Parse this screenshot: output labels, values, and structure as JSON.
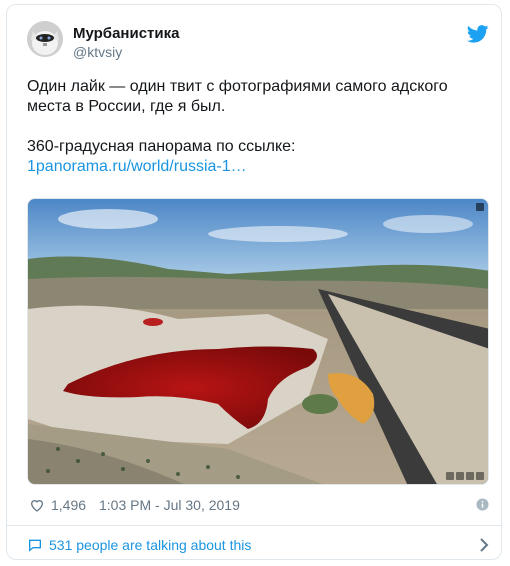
{
  "author": {
    "display_name": "Мурбанистика",
    "handle": "@ktvsiy",
    "avatar_icon": "cat-avatar"
  },
  "tweet": {
    "line1": "Один лайк — один твит с фотографиями самого адского места в России, где я был.",
    "line2": "360-градусная панорама по ссылке:",
    "link_text": "1panorama.ru/world/russia-1…"
  },
  "media": {
    "type": "aerial-panorama-photo",
    "subject": "red lake in quarry landscape"
  },
  "meta": {
    "likes": "1,496",
    "timestamp": "1:03 PM - Jul 30, 2019"
  },
  "talk": {
    "label": "531 people are talking about this"
  },
  "colors": {
    "link": "#1b95e0",
    "twitter": "#1da1f2",
    "muted": "#657786",
    "border": "#e1e8ed"
  },
  "icons": [
    "twitter-bird-icon",
    "heart-icon",
    "info-icon",
    "comment-icon",
    "chevron-right-icon"
  ]
}
